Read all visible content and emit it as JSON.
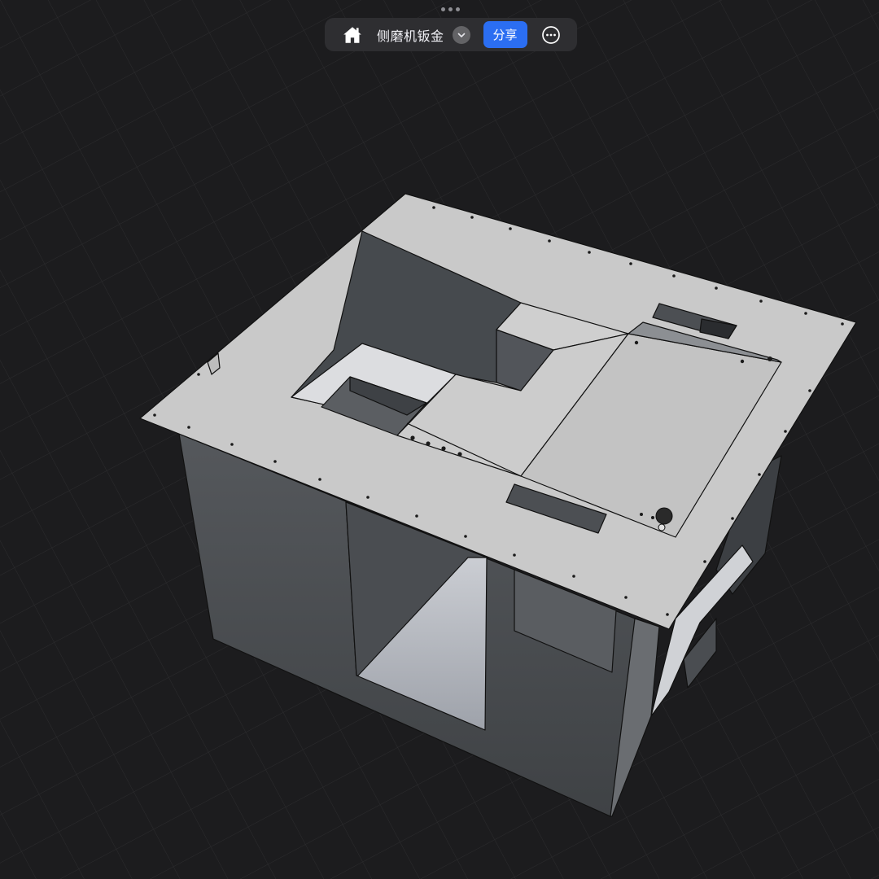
{
  "toolbar": {
    "title": "侧磨机钣金",
    "share_label": "分享"
  },
  "icons": {
    "home": "home-icon",
    "dropdown": "chevron-down-icon",
    "more": "more-icon",
    "grabber": "drag-handle-icon"
  },
  "colors": {
    "background": "#1c1c1e",
    "grid": "#2c2c2e",
    "accent": "#2b6ef2",
    "toolbar_bg": "#2e2e31",
    "sheet_metal_light": "#c6c6c6",
    "sheet_metal_dark": "#4a4d51"
  }
}
